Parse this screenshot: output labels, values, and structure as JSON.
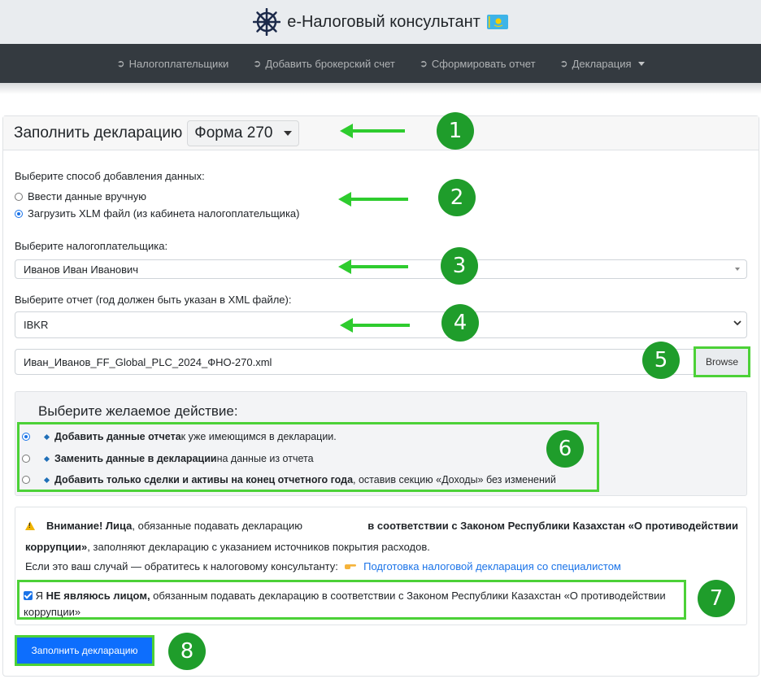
{
  "brand": {
    "title": "е-Налоговый консультант"
  },
  "nav": {
    "items": [
      {
        "label": "Налогоплательщики"
      },
      {
        "label": "Добавить брокерский счет"
      },
      {
        "label": "Сформировать отчет"
      },
      {
        "label": "Декларация"
      }
    ]
  },
  "card": {
    "title": "Заполнить декларацию",
    "form_value": "Форма 270"
  },
  "method": {
    "label": "Выберите способ добавления данных:",
    "options": [
      {
        "label": "Ввести данные вручную",
        "checked": false
      },
      {
        "label": "Загрузить XLM файл (из кабинета налогоплательщика)",
        "checked": true
      }
    ]
  },
  "taxpayer": {
    "label": "Выберите налогоплательщика:",
    "value": "Иванов Иван Иванович"
  },
  "report": {
    "label": "Выберите отчет (год должен быть указан в XML файле):",
    "value": "IBKR"
  },
  "file": {
    "name": "Иван_Иванов_FF_Global_PLC_2024_ФНО-270.xml",
    "browse_label": "Browse"
  },
  "action": {
    "title": "Выберите желаемое действие:",
    "options": [
      {
        "bold": "Добавить данные отчета",
        "rest": " к уже имеющимся в декларации.",
        "checked": true
      },
      {
        "bold": "Заменить данные в декларации",
        "rest": " на данные из отчета",
        "checked": false
      },
      {
        "bold": "Добавить только сделки и активы на конец отчетного года",
        "rest": ", оставив секцию «Доходы» без изменений",
        "checked": false
      }
    ]
  },
  "warning": {
    "line1_bold1": "Внимание! Лица",
    "line1_text": ", обязанные подавать декларацию ",
    "line1_bold2": "в соответствии с Законом Республики Казахстан «О противодействии",
    "line2_bold": "коррупции»",
    "line2_text": ", заполняют декларацию с указанием источников покрытия расходов.",
    "line3_text": "Если это ваш случай — обратитесь к налоговому консультанту:",
    "link_text": "Подготовка налоговой декларация со специалистом"
  },
  "confirm": {
    "text_pre": "Я ",
    "text_bold": "НЕ являюсь лицом,",
    "text_rest": " обязанным подавать декларацию в соответствии с Законом Республики Казахстан «О противодействии",
    "text_line2": "коррупции»",
    "checked": true
  },
  "submit": {
    "label": "Заполнить декларацию"
  },
  "annotations": [
    "1",
    "2",
    "3",
    "4",
    "5",
    "6",
    "7",
    "8"
  ],
  "colors": {
    "accent": "#0d6efd",
    "highlight": "#4cd137",
    "badge": "#1f9d2b",
    "navbar": "#343a40"
  }
}
